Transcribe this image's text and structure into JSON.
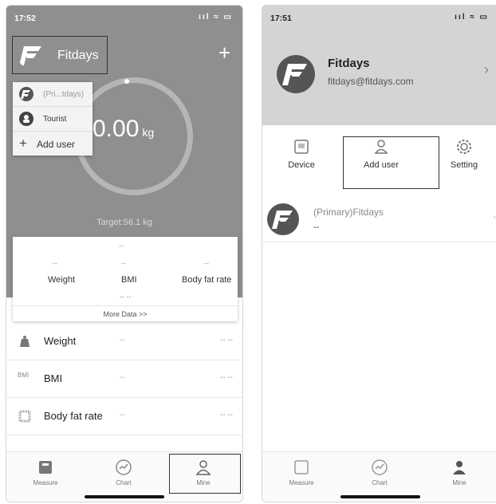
{
  "left": {
    "status": {
      "time": "17:52",
      "icons": "ııl ≈ ▭"
    },
    "brand": "Fitdays",
    "add_icon": "+",
    "dropdown": [
      {
        "label": "(Pri...tdays)"
      },
      {
        "label": "Tourist"
      },
      {
        "label": "Add user"
      }
    ],
    "weight": {
      "value": "0.00",
      "unit": "kg"
    },
    "target": "Target:56.1 kg",
    "card": {
      "top_dash": "--",
      "metrics": [
        {
          "label": "Weight",
          "value": "--"
        },
        {
          "label": "BMI",
          "value": "--"
        },
        {
          "label": "Body fat rate",
          "value": "--"
        }
      ],
      "bottom_dash": "-- --",
      "more": "More Data >>"
    },
    "rows": [
      {
        "label": "Weight",
        "icon": "scale-icon",
        "icon_text": "",
        "value": "--",
        "value2": "-- --"
      },
      {
        "label": "BMI",
        "icon": "bmi-icon",
        "icon_text": "BMI",
        "value": "--",
        "value2": "-- --"
      },
      {
        "label": "Body fat rate",
        "icon": "body-fat-icon",
        "icon_text": "",
        "value": "--",
        "value2": "-- --"
      }
    ],
    "tabs": [
      {
        "label": "Measure"
      },
      {
        "label": "Chart"
      },
      {
        "label": "Mine"
      }
    ]
  },
  "right": {
    "status": {
      "time": "17:51",
      "icons": "ııl ≈ ▭"
    },
    "profile": {
      "name": "Fitdays",
      "email": "fitdays@fitdays.com",
      "chevron": "›"
    },
    "actions": [
      {
        "label": "Device"
      },
      {
        "label": "Add  user"
      },
      {
        "label": "Setting"
      }
    ],
    "user_row": {
      "name": "(Primary)Fitdays",
      "value": "--",
      "right": "--"
    },
    "tabs": [
      {
        "label": "Measure"
      },
      {
        "label": "Chart"
      },
      {
        "label": "Mine"
      }
    ]
  },
  "colors": {
    "header_gray": "#8f8f8f",
    "profile_gray": "#d4d4d4",
    "logo_dark": "#555555"
  }
}
